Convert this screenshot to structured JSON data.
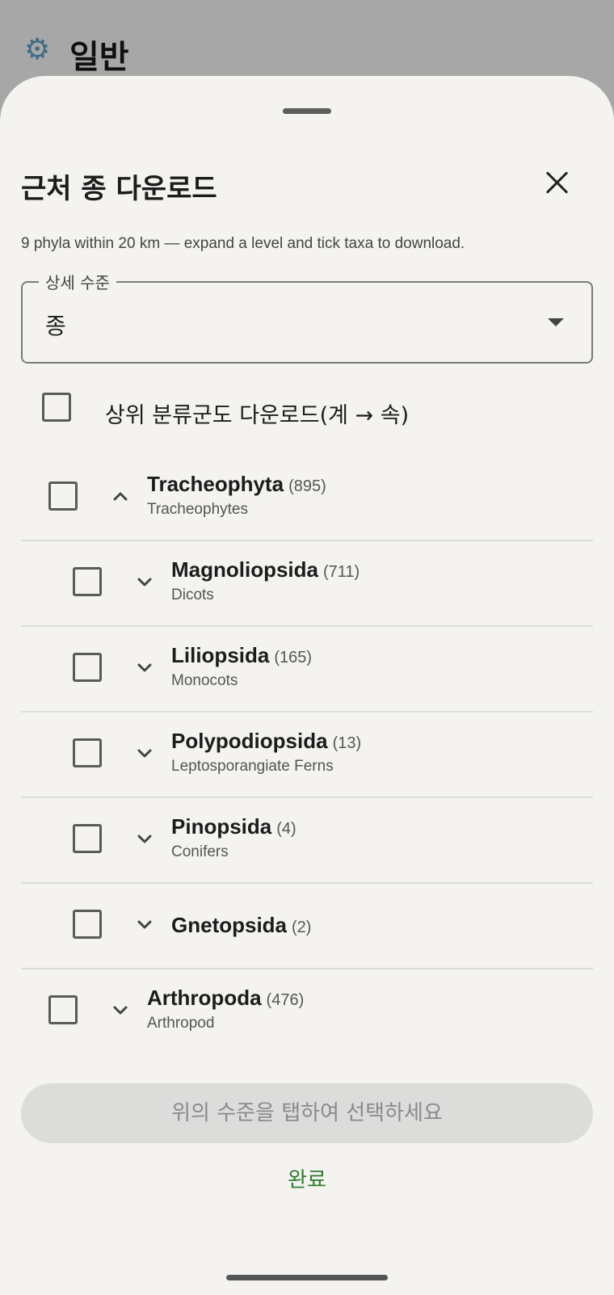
{
  "background": {
    "icon": "gear-icon",
    "title": "일반"
  },
  "sheet": {
    "title": "근처 종 다운로드",
    "subtitle": "9 phyla within 20 km — expand a level and tick taxa to download.",
    "detail_level": {
      "label": "상세 수준",
      "value": "종"
    },
    "higher_taxa_label": "상위 분류군도 다운로드(계 → 속)",
    "taxa": [
      {
        "name": "Tracheophyta",
        "count": "(895)",
        "common": "Tracheophytes",
        "expanded": true,
        "level": 0
      },
      {
        "name": "Magnoliopsida",
        "count": "(711)",
        "common": "Dicots",
        "expanded": false,
        "level": 1
      },
      {
        "name": "Liliopsida",
        "count": "(165)",
        "common": "Monocots",
        "expanded": false,
        "level": 1
      },
      {
        "name": "Polypodiopsida",
        "count": "(13)",
        "common": "Leptosporangiate Ferns",
        "expanded": false,
        "level": 1
      },
      {
        "name": "Pinopsida",
        "count": "(4)",
        "common": "Conifers",
        "expanded": false,
        "level": 1
      },
      {
        "name": "Gnetopsida",
        "count": "(2)",
        "common": "",
        "expanded": false,
        "level": 1
      },
      {
        "name": "Arthropoda",
        "count": "(476)",
        "common": "Arthropod",
        "expanded": false,
        "level": 0
      }
    ],
    "action_button": "위의 수준을 탭하여 선택하세요",
    "done_button": "완료"
  },
  "colors": {
    "accent": "#2e7d32",
    "sheet_bg": "#f4f3f0",
    "scrim": "#a7a7a7"
  }
}
